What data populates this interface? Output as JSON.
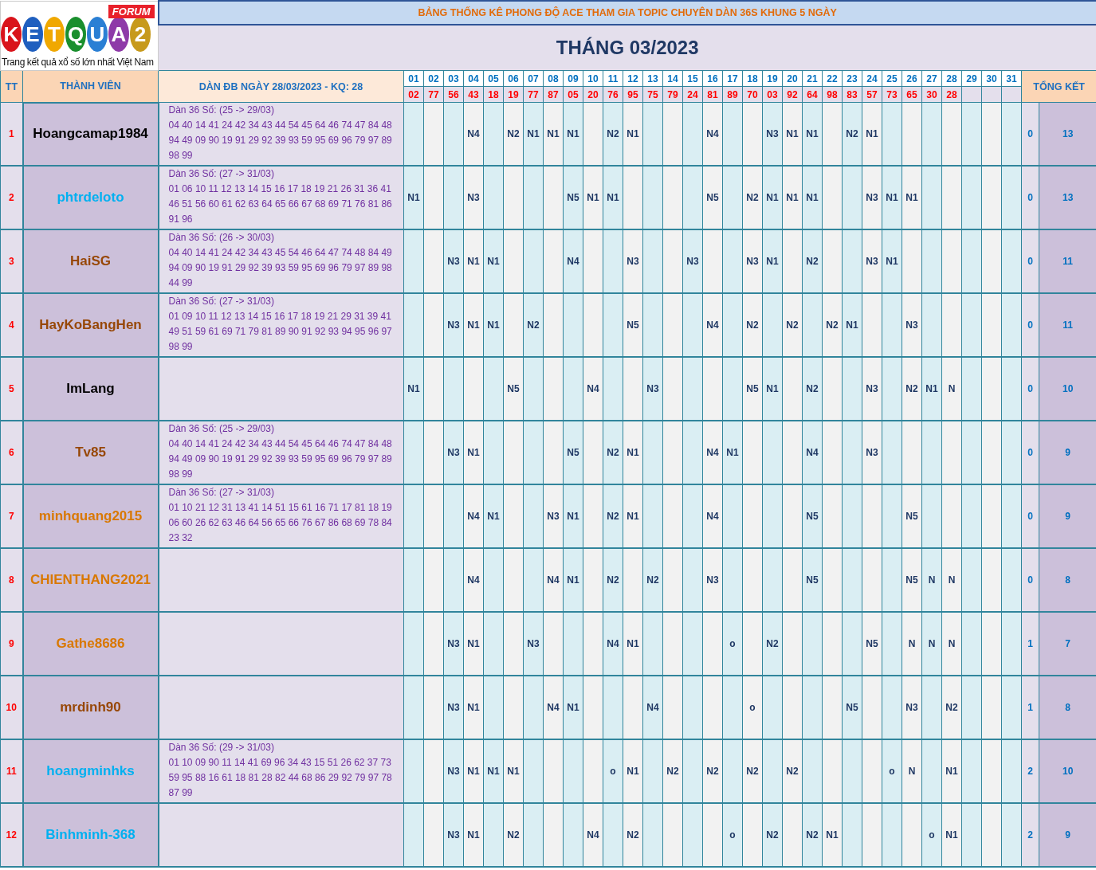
{
  "logo": {
    "letters": [
      "K",
      "E",
      "T",
      "Q",
      "U",
      "A",
      "2"
    ],
    "badge": "FORUM",
    "tagline": "Trang kết quả xổ số lớn nhất Việt Nam"
  },
  "title": "BẢNG THỐNG KÊ PHONG ĐỘ ACE THAM GIA TOPIC CHUYÊN DÀN 36S KHUNG 5 NGÀY",
  "month": "THÁNG 03/2023",
  "columns": {
    "index": "TT",
    "member": "THÀNH VIÊN",
    "dan": "DÀN ĐB NGÀY 28/03/2023 - KQ: 28",
    "total": "TỔNG KẾT"
  },
  "days": [
    "01",
    "02",
    "03",
    "04",
    "05",
    "06",
    "07",
    "08",
    "09",
    "10",
    "11",
    "12",
    "13",
    "14",
    "15",
    "16",
    "17",
    "18",
    "19",
    "20",
    "21",
    "22",
    "23",
    "24",
    "25",
    "26",
    "27",
    "28",
    "29",
    "30",
    "31"
  ],
  "results": [
    "02",
    "77",
    "56",
    "43",
    "18",
    "19",
    "77",
    "87",
    "05",
    "20",
    "76",
    "95",
    "75",
    "79",
    "24",
    "81",
    "89",
    "70",
    "03",
    "92",
    "64",
    "98",
    "83",
    "57",
    "73",
    "65",
    "30",
    "28"
  ],
  "members": [
    {
      "tt": "1",
      "name": "Hoangcamap1984",
      "color": "#000000",
      "dan_heading": "Dàn 36 Số: (25 -> 29/03)",
      "dan_numbers": "04 40 14 41 24 42 34 43 44 54 45 64 46 74 47 84 48 94 49 09 90 19 91 29 92 39 93 59 95 69 96 79 97 89 98 99",
      "marks": {
        "day_04": "N4",
        "day_06": "N2",
        "day_07": "N1",
        "day_08": "N1",
        "day_09": "N1",
        "day_11": "N2",
        "day_12": "N1",
        "day_16": "N4",
        "day_19": "N3",
        "day_20": "N1",
        "day_21": "N1",
        "day_23": "N2",
        "day_24": "N1"
      },
      "total_1": "0",
      "total_2": "13"
    },
    {
      "tt": "2",
      "name": "phtrdeloto",
      "color": "#00b0f0",
      "dan_heading": "Dàn 36 Số: (27 -> 31/03)",
      "dan_numbers": "01 06 10 11 12 13 14 15 16 17 18 19 21 26 31 36 41 46 51 56 60 61 62 63 64 65 66 67 68 69 71 76 81 86 91 96",
      "marks": {
        "day_01": "N1",
        "day_04": "N3",
        "day_09": "N5",
        "day_10": "N1",
        "day_11": "N1",
        "day_16": "N5",
        "day_18": "N2",
        "day_19": "N1",
        "day_20": "N1",
        "day_21": "N1",
        "day_24": "N3",
        "day_25": "N1",
        "day_26": "N1"
      },
      "total_1": "0",
      "total_2": "13"
    },
    {
      "tt": "3",
      "name": "HaiSG",
      "color": "#974706",
      "dan_heading": "Dàn 36 Số: (26 -> 30/03)",
      "dan_numbers": "04 40 14 41 24 42 34 43 45 54 46 64 47 74 48 84 49 94 09 90 19 91 29 92 39 93 59 95 69 96 79 97 89 98 44 99",
      "marks": {
        "day_03": "N3",
        "day_04": "N1",
        "day_05": "N1",
        "day_09": "N4",
        "day_12": "N3",
        "day_15": "N3",
        "day_18": "N3",
        "day_19": "N1",
        "day_21": "N2",
        "day_24": "N3",
        "day_25": "N1"
      },
      "total_1": "0",
      "total_2": "11"
    },
    {
      "tt": "4",
      "name": "HayKoBangHen",
      "color": "#974706",
      "dan_heading": "Dàn 36 Số: (27 -> 31/03)",
      "dan_numbers": "01 09 10 11 12 13 14 15 16 17 18 19 21 29 31 39 41 49 51 59 61 69 71 79 81 89 90 91 92 93 94 95 96 97 98 99",
      "marks": {
        "day_03": "N3",
        "day_04": "N1",
        "day_05": "N1",
        "day_07": "N2",
        "day_12": "N5",
        "day_16": "N4",
        "day_18": "N2",
        "day_20": "N2",
        "day_22": "N2",
        "day_23": "N1",
        "day_26": "N3"
      },
      "total_1": "0",
      "total_2": "11"
    },
    {
      "tt": "5",
      "name": "ImLang",
      "color": "#000000",
      "marks": {
        "day_01": "N1",
        "day_06": "N5",
        "day_10": "N4",
        "day_13": "N3",
        "day_18": "N5",
        "day_19": "N1",
        "day_21": "N2",
        "day_24": "N3",
        "day_26": "N2",
        "day_27": "N1",
        "day_28": "N"
      },
      "total_1": "0",
      "total_2": "10"
    },
    {
      "tt": "6",
      "name": "Tv85",
      "color": "#974706",
      "dan_heading": "Dàn 36 Số: (25 -> 29/03)",
      "dan_numbers": "04 40 14 41 24 42 34 43 44 54 45 64 46 74 47 84 48 94 49 09 90 19 91 29 92 39 93 59 95 69 96 79 97 89 98 99",
      "marks": {
        "day_03": "N3",
        "day_04": "N1",
        "day_09": "N5",
        "day_11": "N2",
        "day_12": "N1",
        "day_16": "N4",
        "day_17": "N1",
        "day_21": "N4",
        "day_24": "N3"
      },
      "total_1": "0",
      "total_2": "9"
    },
    {
      "tt": "7",
      "name": "minhquang2015",
      "color": "#d97800",
      "dan_heading": "Dàn 36 Số: (27 -> 31/03)",
      "dan_numbers": "01 10 21 12 31 13 41 14 51 15 61 16 71 17 81 18 19 06 60 26 62 63 46 64 56 65 66 76 67 86 68 69 78 84 23 32",
      "marks": {
        "day_04": "N4",
        "day_05": "N1",
        "day_08": "N3",
        "day_09": "N1",
        "day_11": "N2",
        "day_12": "N1",
        "day_16": "N4",
        "day_21": "N5",
        "day_26": "N5"
      },
      "total_1": "0",
      "total_2": "9"
    },
    {
      "tt": "8",
      "name": "CHIENTHANG2021",
      "color": "#d97800",
      "marks": {
        "day_04": "N4",
        "day_08": "N4",
        "day_09": "N1",
        "day_11": "N2",
        "day_13": "N2",
        "day_16": "N3",
        "day_21": "N5",
        "day_26": "N5",
        "day_27": "N",
        "day_28": "N"
      },
      "total_1": "0",
      "total_2": "8"
    },
    {
      "tt": "9",
      "name": "Gathe8686",
      "color": "#d97800",
      "marks": {
        "day_03": "N3",
        "day_04": "N1",
        "day_07": "N3",
        "day_11": "N4",
        "day_12": "N1",
        "day_17": "o",
        "day_19": "N2",
        "day_24": "N5",
        "day_26": "N",
        "day_27": "N",
        "day_28": "N"
      },
      "total_1": "1",
      "total_2": "7"
    },
    {
      "tt": "10",
      "name": "mrdinh90",
      "color": "#974706",
      "marks": {
        "day_03": "N3",
        "day_04": "N1",
        "day_08": "N4",
        "day_09": "N1",
        "day_13": "N4",
        "day_18": "o",
        "day_23": "N5",
        "day_26": "N3",
        "day_28": "N2"
      },
      "total_1": "1",
      "total_2": "8"
    },
    {
      "tt": "11",
      "name": "hoangminhks",
      "color": "#00b0f0",
      "dan_heading": "Dàn 36 Số: (29 -> 31/03)",
      "dan_numbers": "01 10 09 90 11 14 41 69 96 34 43 15 51 26 62 37 73 59 95 88 16 61 18 81 28 82 44 68 86 29 92 79 97 78 87 99",
      "marks": {
        "day_03": "N3",
        "day_04": "N1",
        "day_05": "N1",
        "day_06": "N1",
        "day_11": "o",
        "day_12": "N1",
        "day_14": "N2",
        "day_16": "N2",
        "day_18": "N2",
        "day_20": "N2",
        "day_25": "o",
        "day_26": "N",
        "day_28": "N1"
      },
      "total_1": "2",
      "total_2": "10"
    },
    {
      "tt": "12",
      "name": "Binhminh-368",
      "color": "#00b0f0",
      "marks": {
        "day_03": "N3",
        "day_04": "N1",
        "day_06": "N2",
        "day_10": "N4",
        "day_12": "N2",
        "day_17": "o",
        "day_19": "N2",
        "day_21": "N2",
        "day_22": "N1",
        "day_27": "o",
        "day_28": "N1"
      },
      "total_1": "2",
      "total_2": "9"
    }
  ]
}
